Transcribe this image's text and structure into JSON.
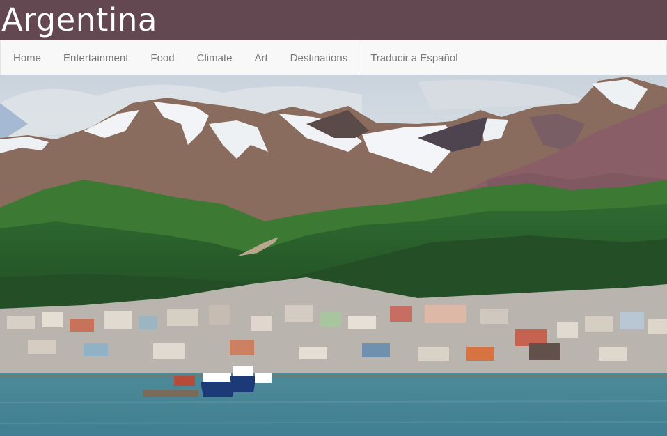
{
  "header": {
    "title": "Argentina",
    "background_color": "#634751"
  },
  "nav": {
    "items": [
      {
        "label": "Home"
      },
      {
        "label": "Entertainment"
      },
      {
        "label": "Food"
      },
      {
        "label": "Climate"
      },
      {
        "label": "Art"
      },
      {
        "label": "Destinations"
      }
    ],
    "translate_label": "Traducir a Español"
  },
  "hero": {
    "image": "ushuaia-harbor-photo"
  }
}
